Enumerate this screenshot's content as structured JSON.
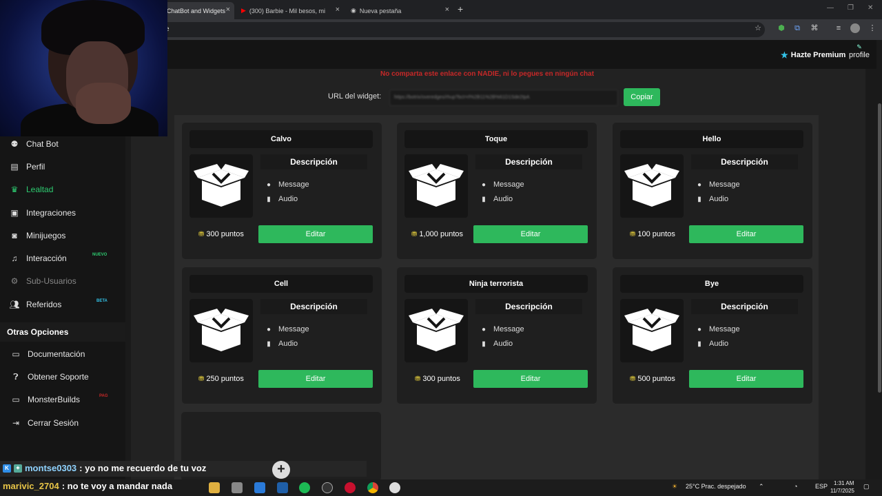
{
  "browser": {
    "tabs": [
      {
        "title": "ChatBot and Widgets"
      },
      {
        "title": "(300) Barbie - Mil besos, mil be"
      },
      {
        "title": "Nueva pestaña"
      }
    ],
    "address": "e"
  },
  "site": {
    "premium_label": "Hazte Premium",
    "profile_label": "profile"
  },
  "sidebar": {
    "items": [
      {
        "label": "Chat Bot",
        "icon": "chatbot-icon"
      },
      {
        "label": "Perfil",
        "icon": "profile-card-icon"
      },
      {
        "label": "Lealtad",
        "icon": "trophy-icon"
      },
      {
        "label": "Integraciones",
        "icon": "integrations-icon"
      },
      {
        "label": "Minijuegos",
        "icon": "gamepad-icon"
      },
      {
        "label": "Interacción",
        "icon": "music-note-icon",
        "badge": "NUEVO"
      },
      {
        "label": "Sub-Usuarios",
        "icon": "gear-icon"
      },
      {
        "label": "Referidos",
        "icon": "users-icon",
        "badge": "BETA"
      }
    ],
    "other_title": "Otras Opciones",
    "other_items": [
      {
        "label": "Documentación",
        "icon": "document-icon"
      },
      {
        "label": "Obtener Soporte",
        "icon": "help-icon"
      },
      {
        "label": "MonsterBuilds",
        "icon": "laptop-icon",
        "badge": "PAG"
      },
      {
        "label": "Cerrar Sesión",
        "icon": "logout-icon"
      }
    ]
  },
  "main": {
    "warning": "No comparta este enlace con NADIE, ni lo pegues en ningún chat",
    "url_label": "URL del widget:",
    "url_value": "https://botrix/overedges/rhup?bct=rl%2B11%2B%61D1Sde2tpA",
    "copy_label": "Copiar",
    "desc_label": "Descripción",
    "feature_message": "Message",
    "feature_audio": "Audio",
    "edit_label": "Editar",
    "cards": [
      {
        "title": "Calvo",
        "points": "300 puntos"
      },
      {
        "title": "Toque",
        "points": "1,000 puntos"
      },
      {
        "title": "Hello",
        "points": "100 puntos"
      },
      {
        "title": "Cell",
        "points": "250 puntos"
      },
      {
        "title": "Ninja terrorista",
        "points": "300 puntos"
      },
      {
        "title": "Bye",
        "points": "500 puntos"
      }
    ]
  },
  "chat": [
    {
      "user": "montse0303",
      "message": ": yo no me recuerdo de tu voz"
    },
    {
      "user": "marivic_2704",
      "message": ": no te voy a mandar nada"
    }
  ],
  "taskbar": {
    "weather": "25°C  Prac. despejado",
    "lang": "ESP",
    "time": "1:31 AM",
    "date": "11/7/2025"
  }
}
